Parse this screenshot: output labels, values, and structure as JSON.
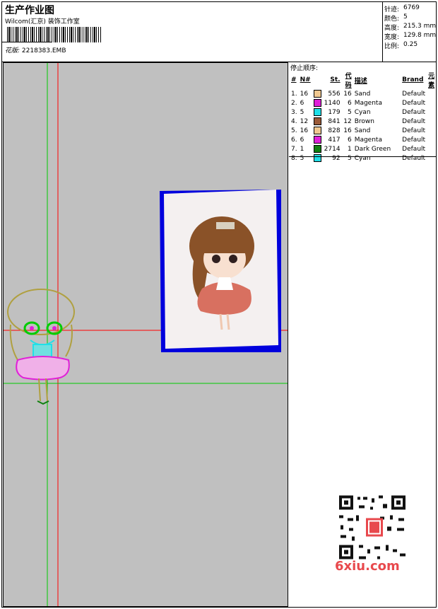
{
  "header": {
    "title": "生产作业图",
    "studio": "Wilcom(汇京) 装饰工作室",
    "design_label": "花版:",
    "design_value": "2218383.EMB"
  },
  "stats": {
    "stitches": {
      "label": "针迹:",
      "value": "6769"
    },
    "colors": {
      "label": "颜色:",
      "value": "5"
    },
    "height": {
      "label": "高度:",
      "value": "215.3 mm"
    },
    "width": {
      "label": "宽度:",
      "value": "129.8 mm"
    },
    "scale": {
      "label": "比例:",
      "value": "0.25"
    }
  },
  "stop_sequence": {
    "title": "停止顺序:",
    "columns": [
      "#",
      "N#",
      "St.",
      "代码",
      "描述",
      "Brand",
      "元素"
    ],
    "rows": [
      {
        "idx": "1.",
        "n": "16",
        "color": "#f0c890",
        "st": "556",
        "code": "16",
        "desc": "Sand",
        "brand": "Default"
      },
      {
        "idx": "2.",
        "n": "6",
        "color": "#e020d8",
        "st": "1140",
        "code": "6",
        "desc": "Magenta",
        "brand": "Default"
      },
      {
        "idx": "3.",
        "n": "5",
        "color": "#20e0e8",
        "st": "179",
        "code": "5",
        "desc": "Cyan",
        "brand": "Default"
      },
      {
        "idx": "4.",
        "n": "12",
        "color": "#9a5a38",
        "st": "841",
        "code": "12",
        "desc": "Brown",
        "brand": "Default"
      },
      {
        "idx": "5.",
        "n": "16",
        "color": "#f0c890",
        "st": "828",
        "code": "16",
        "desc": "Sand",
        "brand": "Default"
      },
      {
        "idx": "6.",
        "n": "6",
        "color": "#e020d8",
        "st": "417",
        "code": "6",
        "desc": "Magenta",
        "brand": "Default"
      },
      {
        "idx": "7.",
        "n": "1",
        "color": "#108010",
        "st": "2714",
        "code": "1",
        "desc": "Dark Green",
        "brand": "Default"
      },
      {
        "idx": "8.",
        "n": "5",
        "color": "#20e0e8",
        "st": "92",
        "code": "5",
        "desc": "Cyan",
        "brand": "Default"
      }
    ]
  },
  "watermark": {
    "text": "6xiu.com",
    "color": "#e8494d"
  },
  "colors": {
    "canvas_bg": "#c0c0c0",
    "guide_red": "#ff0000",
    "guide_green": "#00cc00",
    "photo_frame": "#0000dd"
  }
}
